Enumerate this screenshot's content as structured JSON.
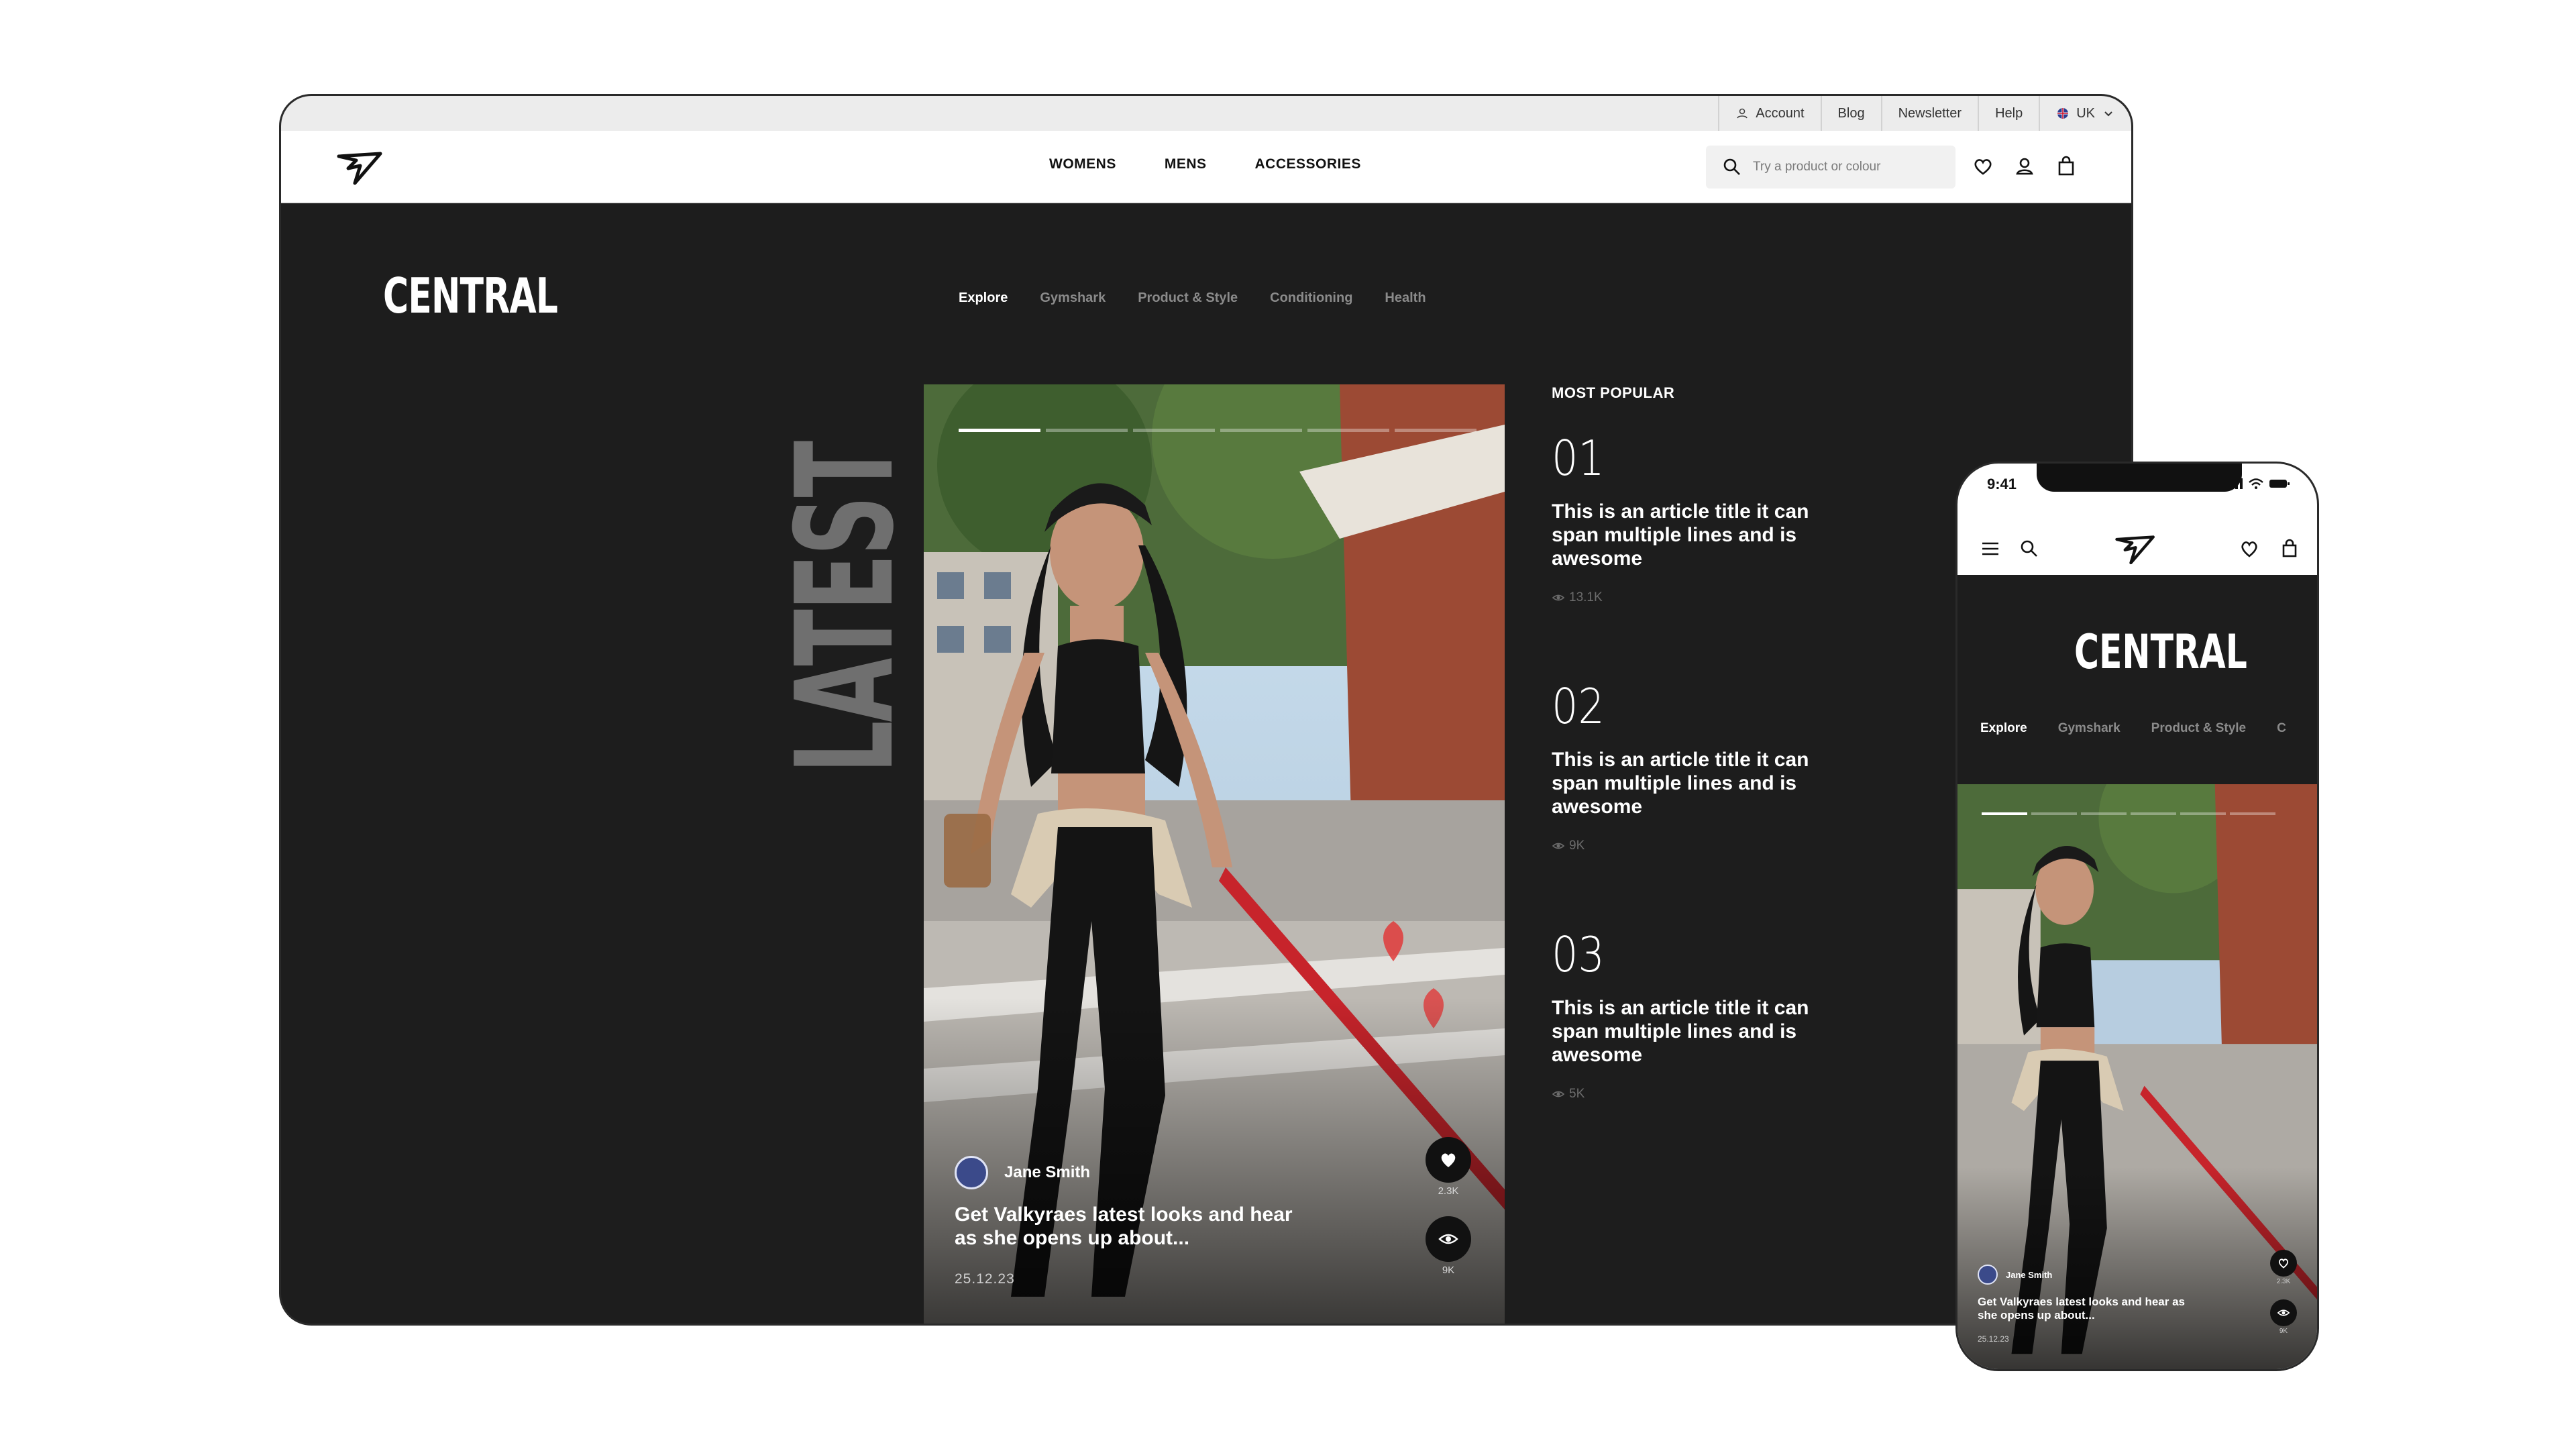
{
  "utility_bar": {
    "account": "Account",
    "blog": "Blog",
    "newsletter": "Newsletter",
    "help": "Help",
    "region": "UK"
  },
  "nav": {
    "links": [
      "WOMENS",
      "MENS",
      "ACCESSORIES"
    ],
    "search_placeholder": "Try a product or colour",
    "icons": [
      "search-icon",
      "heart-icon",
      "user-icon",
      "bag-icon"
    ]
  },
  "page": {
    "title": "CENTRAL",
    "tabs": [
      "Explore",
      "Gymshark",
      "Product & Style",
      "Conditioning",
      "Health"
    ],
    "active_tab": "Explore",
    "section_label": "LATEST"
  },
  "hero": {
    "author": "Jane Smith",
    "title": "Get Valkyraes latest looks and hear as she opens up about...",
    "date": "25.12.23",
    "likes": "2.3K",
    "views": "9K",
    "slide_count": 6,
    "active_slide": 1
  },
  "most_popular": {
    "heading": "MOST POPULAR",
    "items": [
      {
        "num": "01",
        "title": "This is an article title it can span multiple lines and is awesome",
        "views": "13.1K"
      },
      {
        "num": "02",
        "title": "This is an article title it can span multiple lines and is awesome",
        "views": "9K"
      },
      {
        "num": "03",
        "title": "This is an article title it can span multiple lines and is awesome",
        "views": "5K"
      }
    ]
  },
  "phone": {
    "time": "9:41",
    "title": "CENTRAL",
    "tabs": [
      "Explore",
      "Gymshark",
      "Product & Style",
      "C"
    ],
    "author": "Jane Smith",
    "hero_title": "Get Valkyraes latest looks and hear as she opens up about...",
    "date": "25.12.23",
    "likes": "2.3K",
    "views": "9K"
  },
  "colors": {
    "background": "#1d1d1d",
    "nav_bg": "#ffffff",
    "utility_bg": "#ececec",
    "accent_text": "#ffffff",
    "muted_text": "#8a8a8a",
    "latest_text": "#6f6f6f"
  }
}
